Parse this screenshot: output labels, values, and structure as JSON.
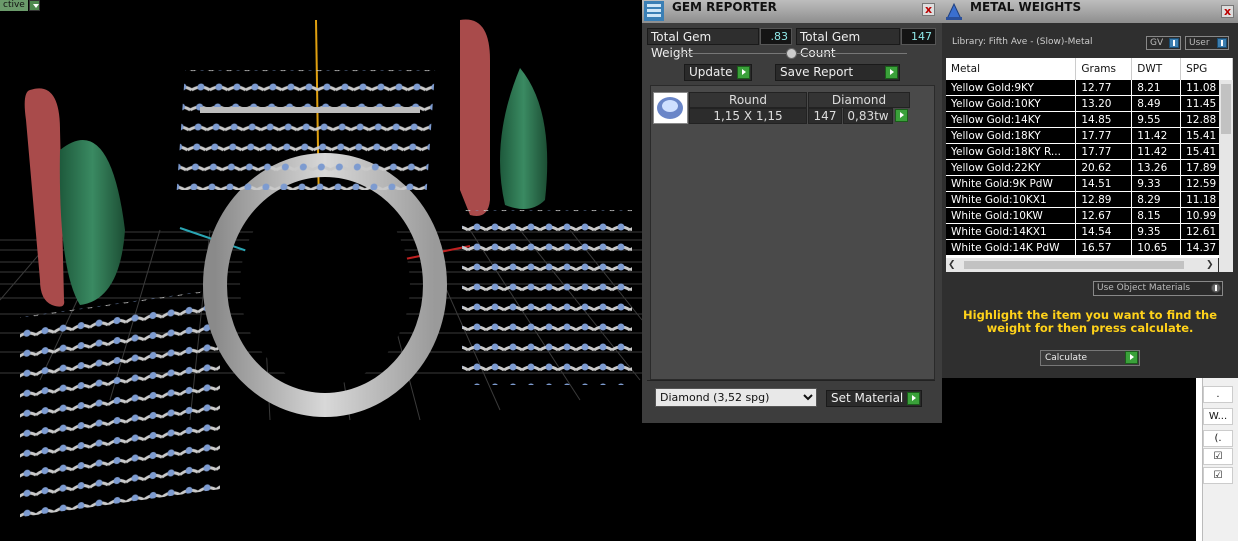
{
  "viewport": {
    "mode_tag": "ctive"
  },
  "gem_reporter": {
    "title": "GEM REPORTER",
    "close_label": "x",
    "total_weight_label": "Total Gem Weight",
    "total_weight_value": ".83",
    "total_count_label": "Total Gem Count",
    "total_count_value": "147",
    "update_label": "Update",
    "save_label": "Save Report",
    "columns": [
      "Round",
      "Diamond"
    ],
    "row": {
      "size": "1,15 X 1,15",
      "count": "147",
      "weight": "0,83tw"
    },
    "material_options": [
      "Diamond     (3,52 spg)"
    ],
    "material_selected": "Diamond     (3,52 spg)",
    "set_material_label": "Set Material"
  },
  "metal_weights": {
    "title": "METAL WEIGHTS",
    "close_label": "x",
    "library": "Library: Fifth Ave - (Slow)-Metal",
    "gv_label": "GV",
    "user_label": "User",
    "columns": [
      "Metal",
      "Grams",
      "DWT",
      "SPG"
    ],
    "rows": [
      [
        "Yellow Gold:9KY",
        "12.77",
        "8.21",
        "11.08"
      ],
      [
        "Yellow Gold:10KY",
        "13.20",
        "8.49",
        "11.45"
      ],
      [
        "Yellow Gold:14KY",
        "14.85",
        "9.55",
        "12.88"
      ],
      [
        "Yellow Gold:18KY",
        "17.77",
        "11.42",
        "15.41"
      ],
      [
        "Yellow Gold:18KY R...",
        "17.77",
        "11.42",
        "15.41"
      ],
      [
        "Yellow Gold:22KY",
        "20.62",
        "13.26",
        "17.89"
      ],
      [
        "White Gold:9K PdW",
        "14.51",
        "9.33",
        "12.59"
      ],
      [
        "White Gold:10KX1",
        "12.89",
        "8.29",
        "11.18"
      ],
      [
        "White Gold:10KW",
        "12.67",
        "8.15",
        "10.99"
      ],
      [
        "White Gold:14KX1",
        "14.54",
        "9.35",
        "12.61"
      ],
      [
        "White Gold:14K PdW",
        "16.57",
        "10.65",
        "14.37"
      ]
    ],
    "use_object_materials": "Use Object Materials",
    "hint": "Highlight the item you want to find the weight for then press calculate.",
    "calculate_label": "Calculate"
  },
  "right_panel": {
    "cells": [
      ".",
      "W...",
      "(.",
      "☑",
      "☑"
    ]
  }
}
